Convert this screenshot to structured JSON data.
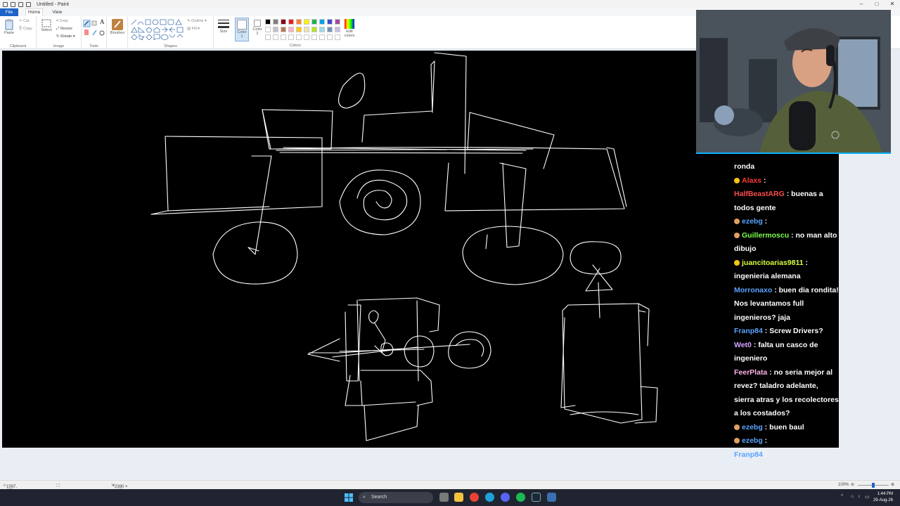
{
  "window": {
    "title": "Untitled - Paint"
  },
  "menu": {
    "file": "File",
    "tabs": [
      "Home",
      "View"
    ]
  },
  "ribbon": {
    "clipboard": {
      "paste": "Paste",
      "cut": "Cut",
      "copy": "Copy",
      "label": "Clipboard"
    },
    "image": {
      "select": "Select",
      "crop": "Crop",
      "resize": "Resize",
      "rotate": "Rotate",
      "label": "Image"
    },
    "tools": {
      "label": "Tools",
      "text": "A"
    },
    "brushes": {
      "label": "Brushes"
    },
    "shapes": {
      "outline": "Outline",
      "fill": "Fill",
      "label": "Shapes"
    },
    "size": {
      "label": "Size"
    },
    "color1": {
      "label": "Color",
      "num": "1"
    },
    "color2": {
      "label": "Color",
      "num": "2"
    },
    "colors": {
      "label": "Colors",
      "edit": "Edit colors",
      "row1": [
        "#000000",
        "#7f7f7f",
        "#880015",
        "#ed1c24",
        "#ff7f27",
        "#fff200",
        "#22b14c",
        "#00a2e8",
        "#3f48cc",
        "#a349a4"
      ],
      "row2": [
        "#ffffff",
        "#c3c3c3",
        "#b97a57",
        "#ffaec9",
        "#ffc90e",
        "#efe4b0",
        "#b5e61d",
        "#99d9ea",
        "#7092be",
        "#c8bfe7"
      ]
    }
  },
  "chat": [
    {
      "user": "",
      "text": "ronda",
      "color": "#ffffff"
    },
    {
      "user": "Alaxs",
      "text": " : ",
      "color": "#ff3b3b",
      "badge": "#f5c518"
    },
    {
      "user": "HalfBeastARG",
      "text": " : buenas a todos gente",
      "color": "#ff4d4d"
    },
    {
      "user": "ezebg",
      "text": " : ",
      "color": "#5aa3ff",
      "badge": "#e0a060"
    },
    {
      "user": "Guillermoscu",
      "text": " : no man alto dibujo",
      "color": "#7dff4d",
      "badge": "#e0a060"
    },
    {
      "user": "juancitoarias9811",
      "text": " : ingenieria alemana",
      "color": "#d8ff3d",
      "badge": "#f5c518"
    },
    {
      "user": "Morronaxo",
      "text": " : buen dia rondita! Nos levantamos full ingenieros? jaja",
      "color": "#5aa3ff"
    },
    {
      "user": "Franp84",
      "text": " : Screw Drivers?",
      "color": "#5aa3ff"
    },
    {
      "user": "Wet0",
      "text": " : falta un casco de ingeniero",
      "color": "#d6a3ff"
    },
    {
      "user": "FeerPlata",
      "text": " : no seria mejor al revez? taladro adelante, sierra atras y los recolectores a los costados?",
      "color": "#ffb3e6"
    },
    {
      "user": "ezebg",
      "text": " : buen baul",
      "color": "#5aa3ff",
      "badge": "#e0a060"
    },
    {
      "user": "ezebg",
      "text": " : ",
      "color": "#5aa3ff",
      "badge": "#e0a060"
    },
    {
      "user": "Franp84",
      "text": " : ",
      "color": "#5aa3ff"
    }
  ],
  "status": {
    "cursor": "1597, 679px",
    "canvas_size": "2380 × 1131px",
    "zoom": "100%"
  },
  "taskbar": {
    "search": "Search",
    "time": "1:44 PM",
    "date": "29-Aug-26"
  },
  "colors": {
    "canvas": "#000000",
    "file_tab": "#1e64c8",
    "ink": "#ffffff",
    "webcam_border": "#0ab3ff"
  }
}
